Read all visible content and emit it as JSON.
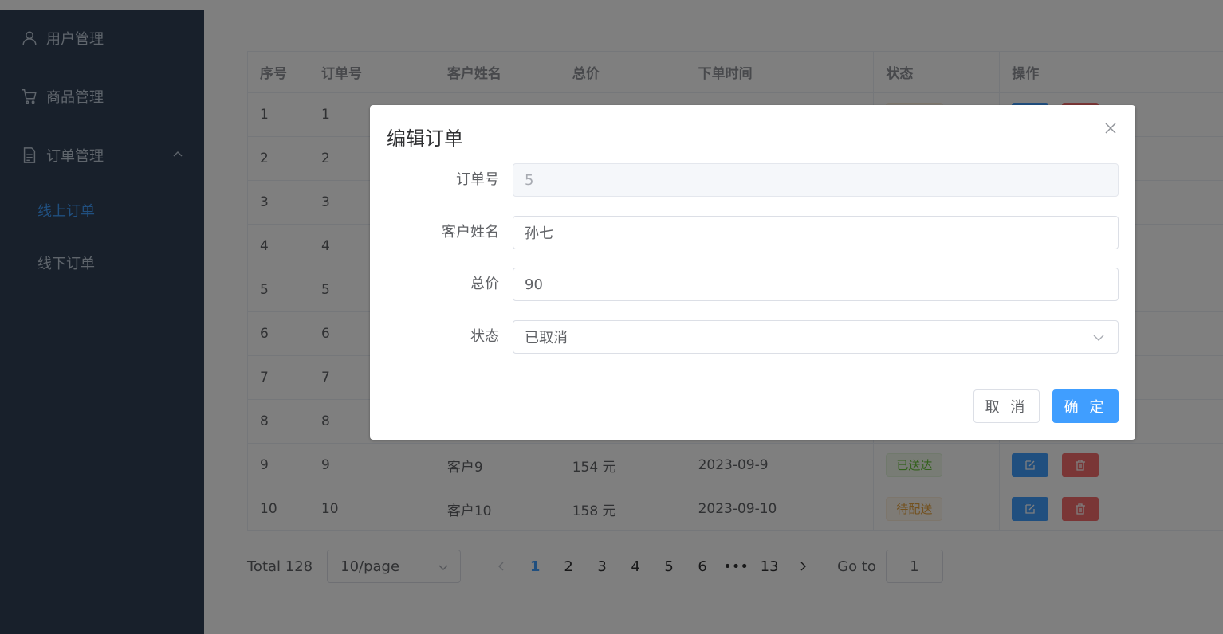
{
  "sidebar": {
    "items": [
      {
        "label": "用户管理",
        "icon": "user-icon"
      },
      {
        "label": "商品管理",
        "icon": "cart-icon"
      },
      {
        "label": "订单管理",
        "icon": "document-icon"
      }
    ],
    "submenu": [
      {
        "label": "线上订单",
        "active": true
      },
      {
        "label": "线下订单",
        "active": false
      }
    ]
  },
  "table": {
    "headers": [
      "序号",
      "订单号",
      "客户姓名",
      "总价",
      "下单时间",
      "状态",
      "操作"
    ],
    "rows": [
      {
        "idx": "1",
        "order": "1"
      },
      {
        "idx": "2",
        "order": "2"
      },
      {
        "idx": "3",
        "order": "3"
      },
      {
        "idx": "4",
        "order": "4"
      },
      {
        "idx": "5",
        "order": "5"
      },
      {
        "idx": "6",
        "order": "6"
      },
      {
        "idx": "7",
        "order": "7"
      },
      {
        "idx": "8",
        "order": "8"
      },
      {
        "idx": "9",
        "order": "9",
        "customer": "客户9",
        "price": "154 元",
        "time": "2023-09-9",
        "status": "已送达"
      },
      {
        "idx": "10",
        "order": "10",
        "customer": "客户10",
        "price": "158 元",
        "time": "2023-09-10",
        "status": "待配送"
      }
    ]
  },
  "pagination": {
    "total": "Total 128",
    "page_size": "10/page",
    "pages": [
      "1",
      "2",
      "3",
      "4",
      "5",
      "6",
      "•••",
      "13"
    ],
    "current": "1",
    "goto_label": "Go to",
    "goto_value": "1"
  },
  "dialog": {
    "title": "编辑订单",
    "fields": {
      "order_label": "订单号",
      "order_value": "5",
      "customer_label": "客户姓名",
      "customer_value": "孙七",
      "price_label": "总价",
      "price_value": "90",
      "status_label": "状态",
      "status_value": "已取消"
    },
    "cancel_label": "取 消",
    "ok_label": "确 定"
  },
  "colors": {
    "sidebar_bg": "#304156",
    "primary": "#409eff",
    "danger": "#f56c6c",
    "success": "#67c23a",
    "warning": "#e6a23c"
  }
}
